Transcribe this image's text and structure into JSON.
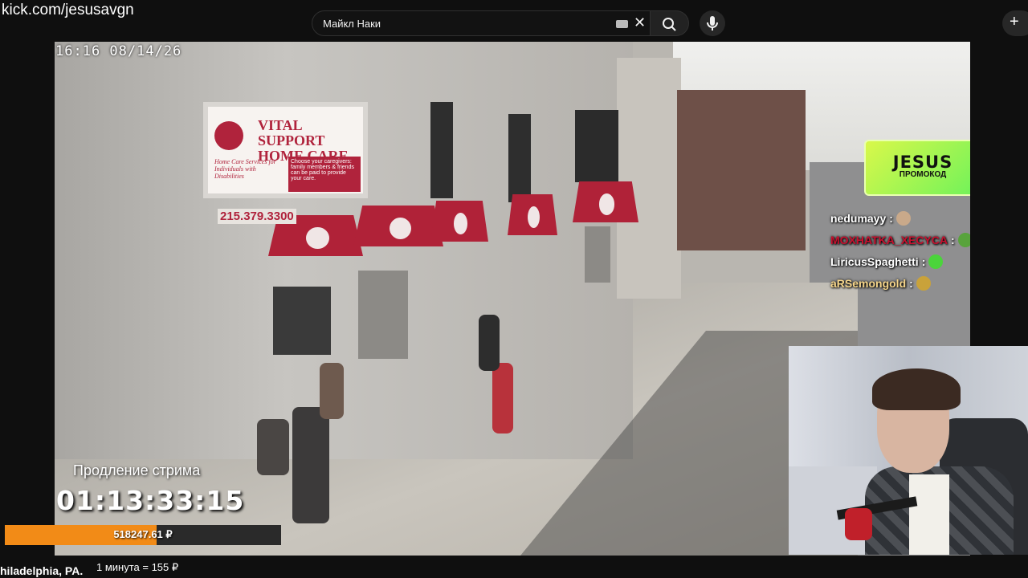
{
  "browser": {
    "url": "kick.com/jesusavgn"
  },
  "search": {
    "value": "Майкл Наки",
    "clear_icon": "close-icon",
    "search_icon": "search-icon",
    "mic_icon": "microphone-icon",
    "create_icon": "plus-icon"
  },
  "stream": {
    "timestamp": "16:16  08/14/26",
    "sign": {
      "title_line1": "VITAL SUPPORT",
      "title_line2": "HOME CARE",
      "body": "Home Care Services for Individuals with Disabilities",
      "box": "Choose your caregivers: family members & friends can be paid to provide your care.",
      "phone": "215.379.3300"
    },
    "promo": {
      "title": "JESUS",
      "subtitle": "ПРОМОКОД",
      "colors": [
        "#d9f84a",
        "#6ef25a"
      ]
    },
    "chat": [
      {
        "user": "nedumayy",
        "sep": ":",
        "color": "#ffffff",
        "emote_color": "#c9a98a"
      },
      {
        "user": "MOXHATKA_XECYCA",
        "sep": ":",
        "color": "#c8102e",
        "emote_color": "#58a33c"
      },
      {
        "user": "LiricusSpaghetti",
        "sep": ":",
        "color": "#ffffff",
        "emote_color": "#4bd43b"
      },
      {
        "user": "aRSemongold",
        "sep": ":",
        "color": "#f5d58a",
        "emote_color": "#c9a23a"
      }
    ],
    "timer_label": "Продление стрима",
    "timer": "01:13:33:15",
    "donation_total": "518247.61 ₽",
    "donation_progress_fraction": 0.55,
    "accent_color": "#f28b17"
  },
  "footer": {
    "location": "hiladelphia, PA.",
    "rate": "1 минута = 155 ₽"
  }
}
